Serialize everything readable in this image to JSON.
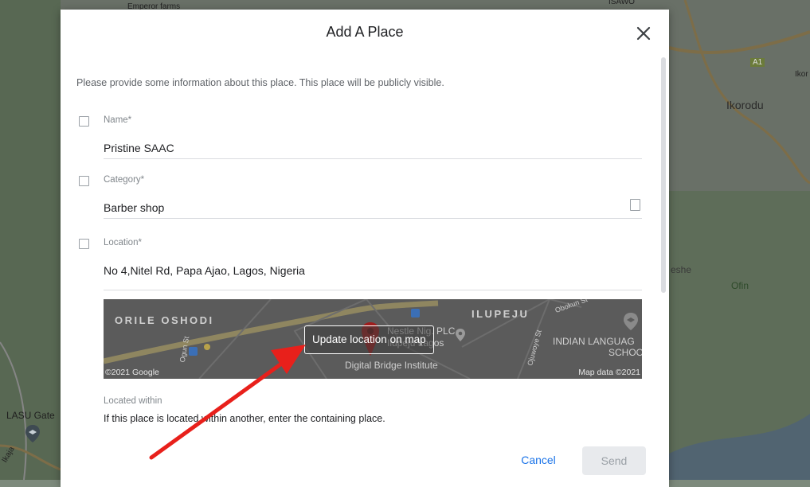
{
  "background_map": {
    "labels": {
      "top_left": "Emperor farms",
      "top_right": "ISAWO",
      "ikorodu": "Ikorodu",
      "a1": "A1",
      "ikor": "Ikor",
      "eshe": "eshe",
      "ofin": "Ofin",
      "lasu": "LASU Gate",
      "kaja": "Ikaja"
    }
  },
  "dialog": {
    "title": "Add A Place",
    "intro": "Please provide some information about this place. This place will be publicly visible.",
    "fields": {
      "name": {
        "label": "Name*",
        "value": "Pristine SAAC"
      },
      "category": {
        "label": "Category*",
        "value": "Barber shop"
      },
      "location": {
        "label": "Location*",
        "value": "No 4,Nitel Rd, Papa Ajao, Lagos, Nigeria"
      }
    },
    "map_preview": {
      "button_label": "Update location on map",
      "credit_left": "©2021 Google",
      "credit_right": "Map data ©2021",
      "labels": {
        "orile": "ORILE OSHODI",
        "ilupeju": "ILUPEJU",
        "nestle": "Nestle Nig. PLC",
        "ilupeju_lagos": "Ilupeju Lagos",
        "indian": "INDIAN LANGUAG",
        "school": "SCHOO",
        "digital": "Digital Bridge Institute",
        "obokun": "Obokun St",
        "ogun": "Ogun St",
        "ojuwoye": "Ojuwoye St"
      }
    },
    "located_within": {
      "label": "Located within",
      "help": "If this place is located within another, enter the containing place."
    },
    "buttons": {
      "cancel": "Cancel",
      "send": "Send"
    }
  },
  "colors": {
    "accent_blue": "#1a73e8",
    "annotation_arrow": "#e8201b",
    "pin_red": "#c5221f"
  }
}
